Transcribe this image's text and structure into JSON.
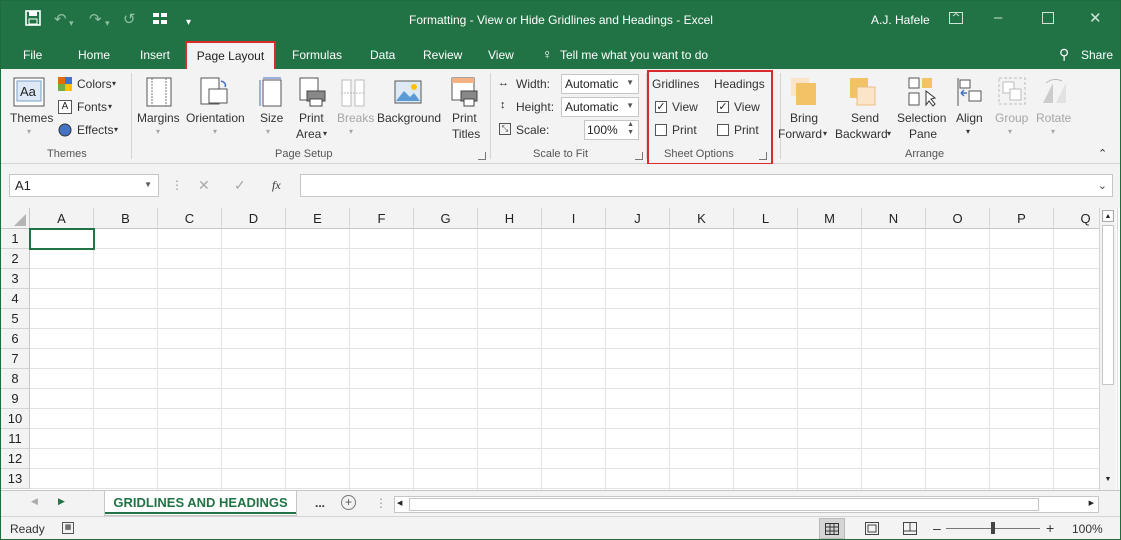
{
  "title_bar": {
    "window_title": "Formatting - View or Hide Gridlines and Headings  -  Excel",
    "user": "A.J. Hafele"
  },
  "tabs": [
    "File",
    "Home",
    "Insert",
    "Page Layout",
    "Formulas",
    "Data",
    "Review",
    "View"
  ],
  "tell_me": "Tell me what you want to do",
  "share": "Share",
  "ribbon": {
    "themes": {
      "themes_label": "Themes",
      "colors": "Colors",
      "fonts": "Fonts",
      "effects": "Effects",
      "group": "Themes"
    },
    "page_setup": {
      "margins": "Margins",
      "orientation": "Orientation",
      "size": "Size",
      "print_area_1": "Print",
      "print_area_2": "Area",
      "breaks": "Breaks",
      "background": "Background",
      "print_titles_1": "Print",
      "print_titles_2": "Titles",
      "group": "Page Setup"
    },
    "scale_to_fit": {
      "width_label": "Width:",
      "width_value": "Automatic",
      "height_label": "Height:",
      "height_value": "Automatic",
      "scale_label": "Scale:",
      "scale_value": "100%",
      "group": "Scale to Fit"
    },
    "sheet_options": {
      "gridlines": "Gridlines",
      "headings": "Headings",
      "view": "View",
      "print": "Print",
      "group": "Sheet Options",
      "gridlines_view": true,
      "gridlines_print": false,
      "headings_view": true,
      "headings_print": false
    },
    "arrange": {
      "bring_1": "Bring",
      "bring_2": "Forward",
      "send_1": "Send",
      "send_2": "Backward",
      "selection_1": "Selection",
      "selection_2": "Pane",
      "align": "Align",
      "group_btn": "Group",
      "rotate": "Rotate",
      "group": "Arrange"
    }
  },
  "formula_bar": {
    "name_box": "A1",
    "fx": "fx",
    "formula": ""
  },
  "columns": [
    "A",
    "B",
    "C",
    "D",
    "E",
    "F",
    "G",
    "H",
    "I",
    "J",
    "K",
    "L",
    "M",
    "N",
    "O",
    "P",
    "Q"
  ],
  "rows": [
    "1",
    "2",
    "3",
    "4",
    "5",
    "6",
    "7",
    "8",
    "9",
    "10",
    "11",
    "12",
    "13"
  ],
  "sheet_tab": "GRIDLINES AND HEADINGS",
  "more_sheets": "...",
  "status": {
    "ready": "Ready",
    "zoom": "100%"
  },
  "colors": {
    "excel_green": "#217346",
    "highlight_red": "#d92b2b",
    "ribbon_bg": "#f3f3f3"
  }
}
